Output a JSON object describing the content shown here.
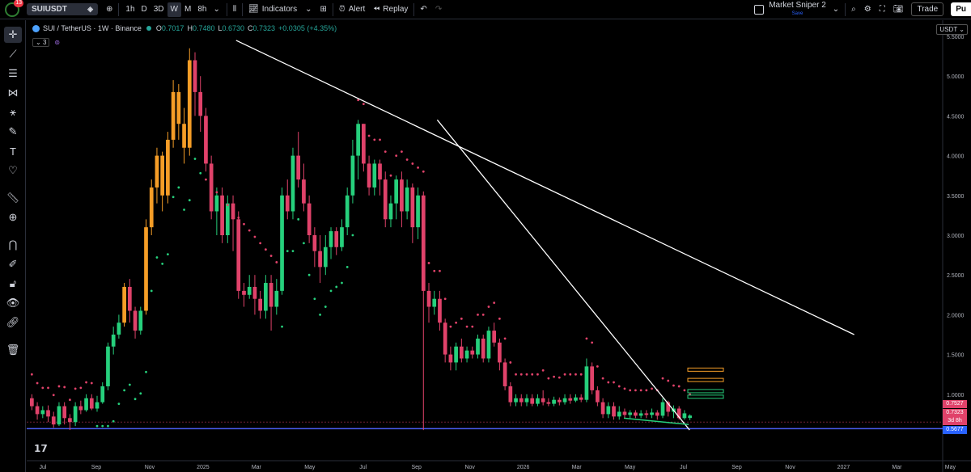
{
  "toolbar": {
    "notification_count": "13",
    "symbol": "SUIUSDT",
    "timeframes": [
      "1h",
      "D",
      "3D",
      "W",
      "M",
      "8h"
    ],
    "active_timeframe": "W",
    "indicators_label": "Indicators",
    "alert_label": "Alert",
    "replay_label": "Replay",
    "layout_name": "Market Sniper 2",
    "layout_status": "Save",
    "trade_label": "Trade",
    "publish_label": "Pu"
  },
  "legend": {
    "title": "SUI / TetherUS · 1W · Binance",
    "open_label": "O",
    "open": "0.7017",
    "high_label": "H",
    "high": "0.7480",
    "low_label": "L",
    "low": "0.6730",
    "close_label": "C",
    "close": "0.7323",
    "change": "+0.0305 (+4.35%)",
    "indicator_count": "3"
  },
  "currency": "USDT",
  "price_tags": {
    "tag1": "0.7527",
    "tag2": "0.7323",
    "tag2_time": "3d 8h",
    "tag3": "0.5677"
  },
  "colors": {
    "up": "#26d07c",
    "down": "#e0426a",
    "orange": "#f59d27",
    "trendline": "#ffffff",
    "support_line": "#4a5cf0",
    "psar_dot_red": "#e0426a",
    "psar_dot_green": "#26d07c",
    "background": "#000000"
  },
  "chart_data": {
    "type": "candlestick",
    "ylim": [
      0.5,
      5.5
    ],
    "y_ticks": [
      "5.5000",
      "5.0000",
      "4.5000",
      "4.0000",
      "3.5000",
      "3.0000",
      "2.5000",
      "2.0000",
      "1.5000",
      "1.0000"
    ],
    "x_ticks": [
      "Jul",
      "Sep",
      "Nov",
      "2025",
      "Mar",
      "May",
      "Jul",
      "Sep",
      "Nov",
      "2026",
      "Mar",
      "May",
      "Jul",
      "Sep",
      "Nov",
      "2027",
      "Mar",
      "May"
    ],
    "candles": [
      {
        "o": 0.95,
        "c": 0.85,
        "h": 1.0,
        "l": 0.8
      },
      {
        "o": 0.85,
        "c": 0.75,
        "h": 0.9,
        "l": 0.68
      },
      {
        "o": 0.75,
        "c": 0.8,
        "h": 0.85,
        "l": 0.7
      },
      {
        "o": 0.8,
        "c": 0.72,
        "h": 0.86,
        "l": 0.65
      },
      {
        "o": 0.72,
        "c": 0.62,
        "h": 0.78,
        "l": 0.58
      },
      {
        "o": 0.62,
        "c": 0.85,
        "h": 0.9,
        "l": 0.6
      },
      {
        "o": 0.85,
        "c": 0.7,
        "h": 0.9,
        "l": 0.62
      },
      {
        "o": 0.7,
        "c": 0.65,
        "h": 0.75,
        "l": 0.55
      },
      {
        "o": 0.65,
        "c": 0.85,
        "h": 0.9,
        "l": 0.6
      },
      {
        "o": 0.85,
        "c": 0.8,
        "h": 0.92,
        "l": 0.75
      },
      {
        "o": 0.8,
        "c": 0.95,
        "h": 1.0,
        "l": 0.78
      },
      {
        "o": 0.95,
        "c": 0.82,
        "h": 1.0,
        "l": 0.8
      },
      {
        "o": 0.82,
        "c": 0.9,
        "h": 0.98,
        "l": 0.78
      },
      {
        "o": 0.9,
        "c": 1.1,
        "h": 1.15,
        "l": 0.88
      },
      {
        "o": 1.1,
        "c": 1.6,
        "h": 1.65,
        "l": 1.05
      },
      {
        "o": 1.6,
        "c": 1.75,
        "h": 1.85,
        "l": 1.5
      },
      {
        "o": 1.75,
        "c": 1.9,
        "h": 2.0,
        "l": 1.7
      },
      {
        "o": 1.9,
        "c": 2.35,
        "h": 2.4,
        "l": 1.85,
        "orange": true
      },
      {
        "o": 2.35,
        "c": 2.05,
        "h": 2.45,
        "l": 1.9
      },
      {
        "o": 2.05,
        "c": 1.8,
        "h": 2.1,
        "l": 1.7
      },
      {
        "o": 1.8,
        "c": 2.05,
        "h": 2.1,
        "l": 1.75
      },
      {
        "o": 2.05,
        "c": 3.1,
        "h": 3.2,
        "l": 2.0,
        "orange": true
      },
      {
        "o": 3.1,
        "c": 3.6,
        "h": 3.7,
        "l": 3.0,
        "orange": true
      },
      {
        "o": 3.6,
        "c": 4.0,
        "h": 4.1,
        "l": 3.4,
        "orange": true
      },
      {
        "o": 4.0,
        "c": 3.5,
        "h": 4.05,
        "l": 3.3,
        "orange": true
      },
      {
        "o": 3.5,
        "c": 4.2,
        "h": 4.3,
        "l": 3.4,
        "orange": true
      },
      {
        "o": 4.2,
        "c": 4.8,
        "h": 4.95,
        "l": 4.1,
        "orange": true
      },
      {
        "o": 4.8,
        "c": 4.4,
        "h": 4.9,
        "l": 4.2,
        "orange": true
      },
      {
        "o": 4.4,
        "c": 4.1,
        "h": 4.6,
        "l": 3.9,
        "orange": true
      },
      {
        "o": 4.1,
        "c": 5.2,
        "h": 5.35,
        "l": 4.0,
        "orange": true
      },
      {
        "o": 5.2,
        "c": 4.8,
        "h": 5.3,
        "l": 4.5
      },
      {
        "o": 4.8,
        "c": 4.5,
        "h": 5.0,
        "l": 4.3
      },
      {
        "o": 4.5,
        "c": 3.9,
        "h": 4.6,
        "l": 3.8
      },
      {
        "o": 3.9,
        "c": 3.3,
        "h": 4.0,
        "l": 3.2
      },
      {
        "o": 3.3,
        "c": 3.5,
        "h": 3.6,
        "l": 3.0
      },
      {
        "o": 3.5,
        "c": 3.0,
        "h": 3.6,
        "l": 2.9
      },
      {
        "o": 3.0,
        "c": 3.4,
        "h": 3.5,
        "l": 2.9
      },
      {
        "o": 3.4,
        "c": 3.2,
        "h": 3.5,
        "l": 2.8
      },
      {
        "o": 3.2,
        "c": 2.3,
        "h": 3.3,
        "l": 2.2
      },
      {
        "o": 2.3,
        "c": 2.25,
        "h": 2.4,
        "l": 2.1
      },
      {
        "o": 2.25,
        "c": 2.35,
        "h": 2.5,
        "l": 2.2
      },
      {
        "o": 2.35,
        "c": 2.2,
        "h": 2.5,
        "l": 2.0
      },
      {
        "o": 2.2,
        "c": 2.05,
        "h": 2.3,
        "l": 1.95
      },
      {
        "o": 2.05,
        "c": 2.4,
        "h": 2.5,
        "l": 1.95
      },
      {
        "o": 2.4,
        "c": 2.1,
        "h": 2.5,
        "l": 1.8
      },
      {
        "o": 2.1,
        "c": 2.3,
        "h": 2.45,
        "l": 2.0
      },
      {
        "o": 2.3,
        "c": 3.5,
        "h": 3.6,
        "l": 2.25
      },
      {
        "o": 3.5,
        "c": 3.3,
        "h": 3.7,
        "l": 3.2
      },
      {
        "o": 3.3,
        "c": 4.0,
        "h": 4.1,
        "l": 3.2
      },
      {
        "o": 4.0,
        "c": 3.7,
        "h": 4.3,
        "l": 3.6
      },
      {
        "o": 3.7,
        "c": 3.4,
        "h": 3.9,
        "l": 3.3
      },
      {
        "o": 3.4,
        "c": 3.0,
        "h": 3.5,
        "l": 2.9
      },
      {
        "o": 3.0,
        "c": 2.8,
        "h": 3.1,
        "l": 2.6
      },
      {
        "o": 2.8,
        "c": 2.6,
        "h": 3.0,
        "l": 2.4
      },
      {
        "o": 2.6,
        "c": 2.85,
        "h": 3.0,
        "l": 2.5
      },
      {
        "o": 2.85,
        "c": 3.05,
        "h": 3.1,
        "l": 2.7
      },
      {
        "o": 3.05,
        "c": 2.85,
        "h": 3.1,
        "l": 2.75
      },
      {
        "o": 2.85,
        "c": 3.1,
        "h": 3.2,
        "l": 2.8
      },
      {
        "o": 3.1,
        "c": 3.5,
        "h": 3.6,
        "l": 3.0
      },
      {
        "o": 3.5,
        "c": 4.0,
        "h": 4.2,
        "l": 3.4
      },
      {
        "o": 4.0,
        "c": 4.4,
        "h": 4.45,
        "l": 3.7
      },
      {
        "o": 4.4,
        "c": 3.9,
        "h": 4.4,
        "l": 3.8
      },
      {
        "o": 3.9,
        "c": 3.6,
        "h": 4.0,
        "l": 3.5
      },
      {
        "o": 3.6,
        "c": 3.9,
        "h": 3.95,
        "l": 3.5
      },
      {
        "o": 3.9,
        "c": 3.7,
        "h": 3.95,
        "l": 3.5
      },
      {
        "o": 3.7,
        "c": 3.2,
        "h": 3.8,
        "l": 3.1
      },
      {
        "o": 3.2,
        "c": 3.4,
        "h": 3.5,
        "l": 3.1
      },
      {
        "o": 3.4,
        "c": 3.7,
        "h": 3.75,
        "l": 3.2
      },
      {
        "o": 3.7,
        "c": 3.3,
        "h": 3.8,
        "l": 3.1
      },
      {
        "o": 3.3,
        "c": 3.6,
        "h": 3.7,
        "l": 3.2
      },
      {
        "o": 3.6,
        "c": 3.1,
        "h": 3.65,
        "l": 2.9
      },
      {
        "o": 3.1,
        "c": 3.5,
        "h": 3.6,
        "l": 2.95
      },
      {
        "o": 3.5,
        "c": 2.3,
        "h": 3.55,
        "l": 0.55
      },
      {
        "o": 2.3,
        "c": 2.1,
        "h": 2.4,
        "l": 1.9
      },
      {
        "o": 2.1,
        "c": 2.2,
        "h": 2.3,
        "l": 2.0
      },
      {
        "o": 2.2,
        "c": 1.9,
        "h": 2.3,
        "l": 1.8
      },
      {
        "o": 1.9,
        "c": 1.5,
        "h": 1.95,
        "l": 1.4
      },
      {
        "o": 1.5,
        "c": 1.4,
        "h": 1.6,
        "l": 1.3
      },
      {
        "o": 1.4,
        "c": 1.6,
        "h": 1.65,
        "l": 1.3
      },
      {
        "o": 1.6,
        "c": 1.45,
        "h": 1.7,
        "l": 1.4
      },
      {
        "o": 1.45,
        "c": 1.55,
        "h": 1.6,
        "l": 1.4
      },
      {
        "o": 1.55,
        "c": 1.5,
        "h": 1.6,
        "l": 1.45
      },
      {
        "o": 1.5,
        "c": 1.7,
        "h": 1.75,
        "l": 1.45
      },
      {
        "o": 1.7,
        "c": 1.45,
        "h": 1.75,
        "l": 1.4
      },
      {
        "o": 1.45,
        "c": 1.8,
        "h": 1.85,
        "l": 1.4
      },
      {
        "o": 1.8,
        "c": 1.65,
        "h": 1.9,
        "l": 1.6
      },
      {
        "o": 1.65,
        "c": 1.4,
        "h": 1.7,
        "l": 1.3
      },
      {
        "o": 1.4,
        "c": 1.1,
        "h": 1.45,
        "l": 1.05
      },
      {
        "o": 1.1,
        "c": 0.9,
        "h": 1.15,
        "l": 0.85
      },
      {
        "o": 0.9,
        "c": 0.95,
        "h": 1.0,
        "l": 0.85
      },
      {
        "o": 0.95,
        "c": 0.9,
        "h": 1.0,
        "l": 0.85
      },
      {
        "o": 0.9,
        "c": 0.95,
        "h": 1.0,
        "l": 0.85
      },
      {
        "o": 0.95,
        "c": 0.88,
        "h": 1.0,
        "l": 0.85
      },
      {
        "o": 0.88,
        "c": 0.95,
        "h": 1.0,
        "l": 0.85
      },
      {
        "o": 0.95,
        "c": 0.9,
        "h": 1.05,
        "l": 0.86
      },
      {
        "o": 0.9,
        "c": 0.88,
        "h": 0.95,
        "l": 0.85
      },
      {
        "o": 0.88,
        "c": 0.93,
        "h": 0.97,
        "l": 0.85
      },
      {
        "o": 0.93,
        "c": 0.9,
        "h": 0.96,
        "l": 0.86
      },
      {
        "o": 0.9,
        "c": 0.95,
        "h": 1.0,
        "l": 0.87
      },
      {
        "o": 0.95,
        "c": 0.92,
        "h": 1.0,
        "l": 0.88
      },
      {
        "o": 0.92,
        "c": 0.96,
        "h": 1.0,
        "l": 0.9
      },
      {
        "o": 0.96,
        "c": 0.93,
        "h": 1.0,
        "l": 0.9
      },
      {
        "o": 0.93,
        "c": 1.35,
        "h": 1.45,
        "l": 0.9
      },
      {
        "o": 1.35,
        "c": 1.05,
        "h": 1.4,
        "l": 1.0
      },
      {
        "o": 1.05,
        "c": 0.9,
        "h": 1.1,
        "l": 0.85
      },
      {
        "o": 0.9,
        "c": 0.75,
        "h": 0.95,
        "l": 0.7
      },
      {
        "o": 0.75,
        "c": 0.85,
        "h": 0.9,
        "l": 0.7
      },
      {
        "o": 0.85,
        "c": 0.72,
        "h": 0.9,
        "l": 0.68
      },
      {
        "o": 0.72,
        "c": 0.78,
        "h": 0.85,
        "l": 0.68
      },
      {
        "o": 0.78,
        "c": 0.74,
        "h": 0.82,
        "l": 0.7
      },
      {
        "o": 0.74,
        "c": 0.77,
        "h": 0.8,
        "l": 0.7
      },
      {
        "o": 0.77,
        "c": 0.73,
        "h": 0.8,
        "l": 0.7
      },
      {
        "o": 0.73,
        "c": 0.76,
        "h": 0.8,
        "l": 0.7
      },
      {
        "o": 0.76,
        "c": 0.74,
        "h": 0.8,
        "l": 0.7
      },
      {
        "o": 0.74,
        "c": 0.77,
        "h": 0.82,
        "l": 0.7
      },
      {
        "o": 0.77,
        "c": 0.73,
        "h": 0.8,
        "l": 0.68
      },
      {
        "o": 0.73,
        "c": 0.9,
        "h": 0.95,
        "l": 0.7
      },
      {
        "o": 0.9,
        "c": 0.78,
        "h": 0.92,
        "l": 0.72
      },
      {
        "o": 0.78,
        "c": 0.82,
        "h": 0.86,
        "l": 0.7
      },
      {
        "o": 0.82,
        "c": 0.7,
        "h": 0.85,
        "l": 0.68
      },
      {
        "o": 0.7,
        "c": 0.76,
        "h": 0.8,
        "l": 0.68
      },
      {
        "o": 0.7017,
        "c": 0.7323,
        "h": 0.748,
        "l": 0.673
      }
    ],
    "trendlines": [
      {
        "from": [
          0.229,
          5.45
        ],
        "to": [
          0.905,
          1.75
        ]
      },
      {
        "from": [
          0.449,
          4.45
        ],
        "to": [
          0.725,
          0.55
        ]
      }
    ],
    "support_level": 0.5677,
    "dashed_level": 0.7527
  }
}
